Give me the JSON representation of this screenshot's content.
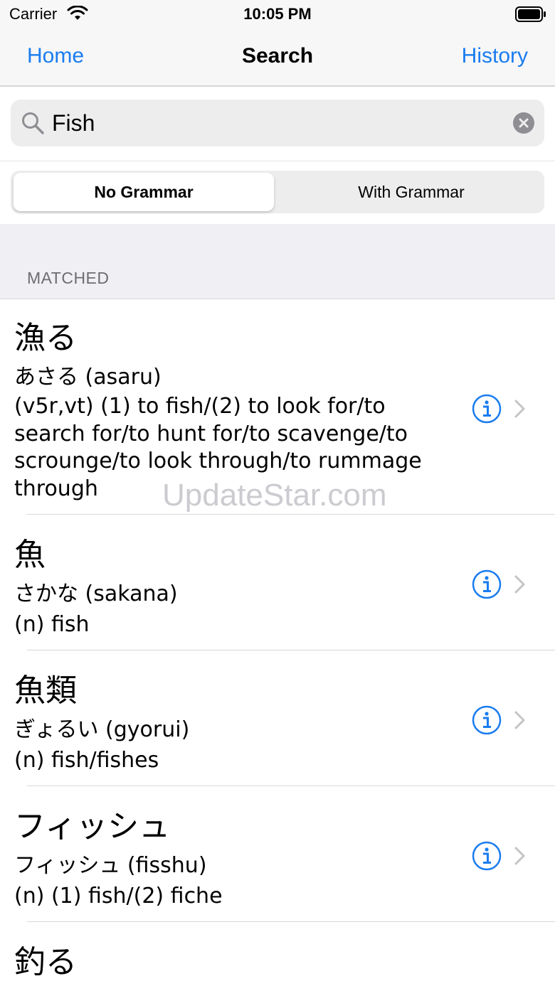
{
  "status_bar": {
    "carrier": "Carrier",
    "time": "10:05 PM"
  },
  "nav": {
    "back_label": "Home",
    "title": "Search",
    "right_label": "History"
  },
  "search": {
    "value": "Fish",
    "placeholder": ""
  },
  "segments": [
    "No Grammar",
    "With Grammar"
  ],
  "selected_segment": "No Grammar",
  "section": {
    "title": "MATCHED"
  },
  "results": [
    {
      "kanji": "漁る",
      "reading": "あさる (asaru)",
      "meaning": "(v5r,vt) (1) to fish/(2) to look for/to search for/to hunt for/to scavenge/to scrounge/to look through/to rummage through"
    },
    {
      "kanji": "魚",
      "reading": "さかな (sakana)",
      "meaning": "(n) fish"
    },
    {
      "kanji": "魚類",
      "reading": "ぎょるい (gyorui)",
      "meaning": "(n) fish/fishes"
    },
    {
      "kanji": "フィッシュ",
      "reading": "フィッシュ (fisshu)",
      "meaning": "(n) (1) fish/(2) fiche"
    },
    {
      "kanji": "釣る",
      "reading": "",
      "meaning": ""
    }
  ],
  "watermark": "UpdateStar.com",
  "colors": {
    "accent": "#1a7cf0",
    "secondary_text": "#6d6d72",
    "grouped_bg": "#efeff4"
  },
  "icons": {
    "search": "magnifier-icon",
    "clear": "clear-circle-icon",
    "info": "info-circle-icon",
    "chevron": "chevron-right-icon"
  }
}
